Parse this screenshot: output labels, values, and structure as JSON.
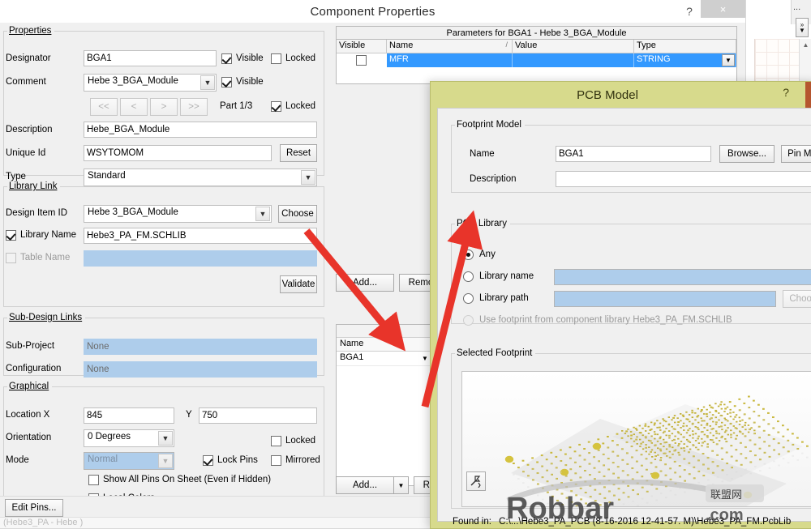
{
  "background_app": {
    "menu_dots": "...",
    "expand_icon": "expand-chevrons",
    "scroll_up_icon": "scroll-up-arrow"
  },
  "component_properties": {
    "title": "Component Properties",
    "help_label": "?",
    "close_label": "×",
    "properties_group": {
      "legend": "Properties",
      "designator": {
        "label": "Designator",
        "value": "BGA1",
        "visible_label": "Visible",
        "visible_checked": true,
        "locked_label": "Locked",
        "locked_checked": false
      },
      "comment": {
        "label": "Comment",
        "value": "Hebe 3_BGA_Module",
        "visible_label": "Visible",
        "visible_checked": true
      },
      "part_nav": {
        "first": "<<",
        "prev": "<",
        "next": ">",
        "last": ">>",
        "part_label": "Part 1/3",
        "locked_label": "Locked",
        "locked_checked": true
      },
      "description": {
        "label": "Description",
        "value": "Hebe_BGA_Module"
      },
      "unique_id": {
        "label": "Unique Id",
        "value": "WSYTOMOM",
        "reset_label": "Reset"
      },
      "type": {
        "label": "Type",
        "value": "Standard"
      }
    },
    "library_link_group": {
      "legend": "Library Link",
      "design_item_id": {
        "label": "Design Item ID",
        "value": "Hebe 3_BGA_Module",
        "choose_label": "Choose"
      },
      "library_name": {
        "label": "Library Name",
        "checked": true,
        "value": "Hebe3_PA_FM.SCHLIB"
      },
      "table_name": {
        "label": "Table Name",
        "checked": false,
        "value": ""
      },
      "validate_label": "Validate"
    },
    "sub_design_links_group": {
      "legend": "Sub-Design Links",
      "sub_project": {
        "label": "Sub-Project",
        "value": "None"
      },
      "configuration": {
        "label": "Configuration",
        "value": "None"
      }
    },
    "graphical_group": {
      "legend": "Graphical",
      "location": {
        "label": "Location X",
        "x_value": "845",
        "y_label": "Y",
        "y_value": "750"
      },
      "orientation": {
        "label": "Orientation",
        "value": "0 Degrees",
        "locked_label": "Locked",
        "locked_checked": false
      },
      "mode": {
        "label": "Mode",
        "value": "Normal",
        "lock_pins_label": "Lock Pins",
        "lock_pins_checked": true,
        "mirrored_label": "Mirrored",
        "mirrored_checked": false
      },
      "show_all_pins": {
        "label": "Show All Pins On Sheet (Even if Hidden)",
        "checked": false
      },
      "local_colors": {
        "label": "Local Colors",
        "checked": false
      }
    },
    "parameters_panel": {
      "title": "Parameters for BGA1 - Hebe 3_BGA_Module",
      "columns": [
        "Visible",
        "Name",
        "Value",
        "Type"
      ],
      "sort_indicator": "/",
      "rows": [
        {
          "visible": false,
          "name": "MFR",
          "value": "",
          "type": "STRING",
          "selected": true
        }
      ]
    },
    "params_buttons": {
      "add": "Add...",
      "remove": "Remo"
    },
    "models_list": {
      "column": "Name",
      "rows": [
        "BGA1"
      ],
      "row_dropdown_icon": "chevron-down-icon"
    },
    "models_buttons": {
      "add": "Add...",
      "add_arrow_icon": "chevron-down-icon",
      "remove": "Remo"
    },
    "edit_pins_label": "Edit Pins...",
    "status_text": "(Hebe3_PA - Hebe )",
    "colors": {
      "selection_blue": "#3399ff",
      "field_blue": "#aecdeb"
    }
  },
  "pcb_model": {
    "title": "PCB Model",
    "help_label": "?",
    "footprint_group": {
      "legend": "Footprint Model",
      "name": {
        "label": "Name",
        "value": "BGA1"
      },
      "browse_label": "Browse...",
      "pin_map_label": "Pin Map...",
      "description": {
        "label": "Description",
        "value": ""
      }
    },
    "pcb_library_group": {
      "legend": "PCB Library",
      "options": [
        {
          "label": "Any",
          "selected": true,
          "disabled": false
        },
        {
          "label": "Library name",
          "selected": false,
          "disabled": false,
          "field_value": ""
        },
        {
          "label": "Library path",
          "selected": false,
          "disabled": false,
          "field_value": "",
          "choose_label": "Choose..."
        },
        {
          "label": "Use footprint from component library Hebe3_PA_FM.SCHLIB",
          "selected": false,
          "disabled": true
        }
      ]
    },
    "selected_footprint_group": {
      "legend": "Selected Footprint",
      "preview_alt": "bga-footprint-3d-preview",
      "zoom_icon": "zoom-tool-icon"
    },
    "found_in": {
      "label": "Found in:",
      "path": "C:\\...\\Hebe3_PA_PCB (8-16-2016 12-41-57. M)\\Hebe3_PA_FM.PcbLib"
    },
    "colors": {
      "title_bar": "#d7da8c",
      "close_accent": "#b5562f"
    }
  },
  "annotations": {
    "arrow_1": {
      "name": "arrow-to-models-list",
      "from": [
        378,
        285
      ],
      "to": [
        484,
        414
      ],
      "color": "#e8342a"
    },
    "arrow_2": {
      "name": "arrow-to-any-radio",
      "from": [
        524,
        502
      ],
      "to": [
        578,
        284
      ],
      "color": "#e8342a"
    }
  },
  "watermark": {
    "text": "Robbar",
    "suffix": ".com",
    "badge": "联盟网"
  }
}
